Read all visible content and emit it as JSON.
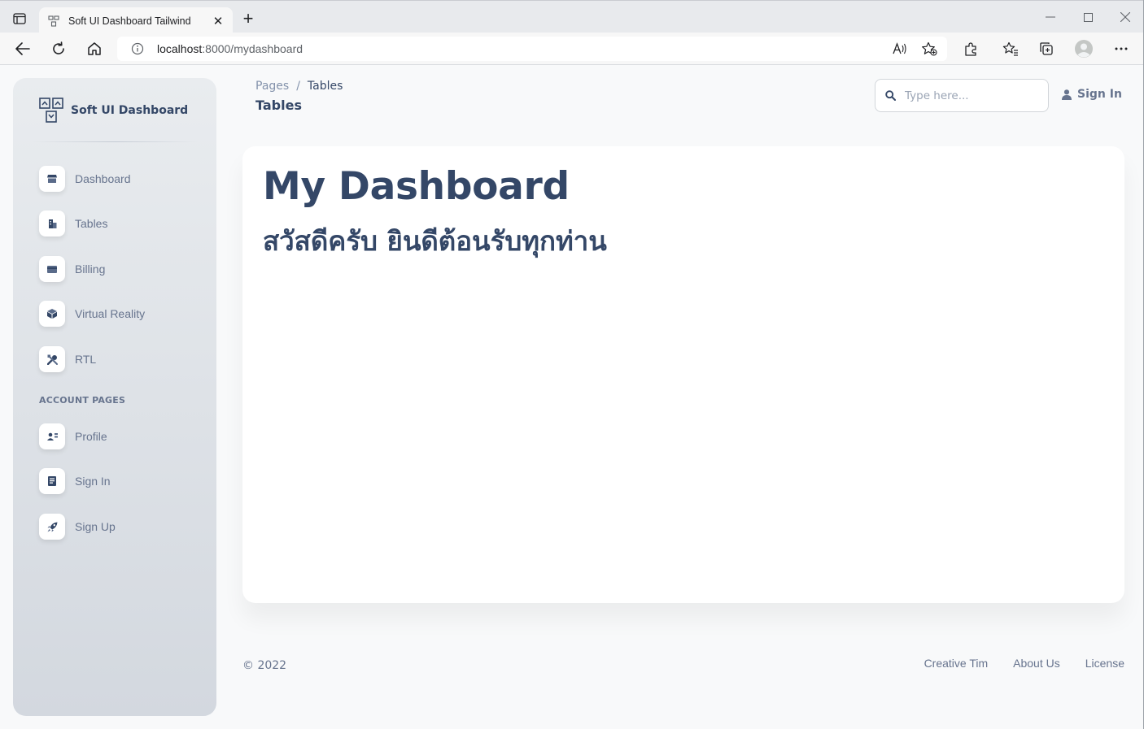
{
  "browser": {
    "tab_title": "Soft UI Dashboard Tailwind",
    "url_host": "localhost",
    "url_rest": ":8000/mydashboard",
    "tab_close": "✕",
    "new_tab": "+"
  },
  "sidebar": {
    "brand": "Soft UI Dashboard",
    "items": [
      {
        "label": "Dashboard",
        "icon": "shop-icon"
      },
      {
        "label": "Tables",
        "icon": "office-icon"
      },
      {
        "label": "Billing",
        "icon": "credit-card-icon"
      },
      {
        "label": "Virtual Reality",
        "icon": "box-icon"
      },
      {
        "label": "RTL",
        "icon": "tools-icon"
      }
    ],
    "section_title": "ACCOUNT PAGES",
    "account_items": [
      {
        "label": "Profile",
        "icon": "user-icon"
      },
      {
        "label": "Sign In",
        "icon": "document-icon"
      },
      {
        "label": "Sign Up",
        "icon": "rocket-icon"
      }
    ]
  },
  "navbar": {
    "breadcrumb_root": "Pages",
    "breadcrumb_sep": "/",
    "breadcrumb_current": "Tables",
    "page_title": "Tables",
    "search_placeholder": "Type here...",
    "signin_label": "Sign In"
  },
  "card": {
    "heading": "My Dashboard",
    "subheading": "สวัสดีครับ ยินดีต้อนรับทุกท่าน"
  },
  "footer": {
    "copyright": "© 2022",
    "links": [
      "Creative Tim",
      "About Us",
      "License"
    ]
  },
  "colors": {
    "text_primary": "#344767",
    "text_secondary": "#67748e",
    "background": "#f8f9fa"
  }
}
